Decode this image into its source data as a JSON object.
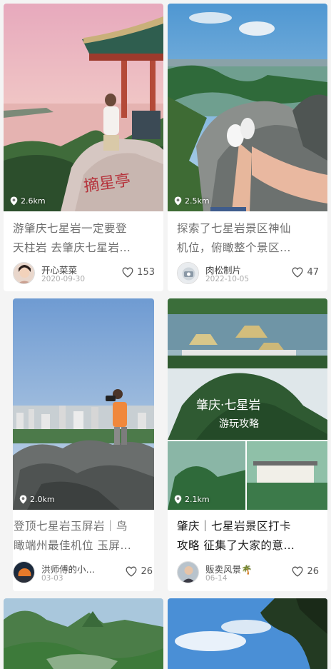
{
  "cards": [
    {
      "distance": "2.6km",
      "title_line1": "游肇庆七星岩一定要登",
      "title_line2": "天柱岩 去肇庆七星岩…",
      "author": "开心菜菜",
      "date": "2020-09-30",
      "likes": "153",
      "image_caption": "摘星亭"
    },
    {
      "distance": "2.5km",
      "title_line1": "探索了七星岩景区神仙",
      "title_line2": "机位，俯瞰整个景区…",
      "author": "肉松制片",
      "date": "2022-10-05",
      "likes": "47"
    },
    {
      "distance": "2.0km",
      "title_line1": "登顶七星岩玉屏岩｜鸟",
      "title_line2": "瞰端州最佳机位 玉屏…",
      "author": "洪师傅的小…",
      "date": "03-03",
      "likes": "26"
    },
    {
      "distance": "2.1km",
      "title_line1": "肇庆｜七星岩景区打卡",
      "title_line2": "攻略 征集了大家的意…",
      "author": "贩卖风景🌴",
      "date": "06-14",
      "likes": "26",
      "image_caption_line1": "肇庆·七星岩",
      "image_caption_line2": "游玩攻略"
    }
  ]
}
